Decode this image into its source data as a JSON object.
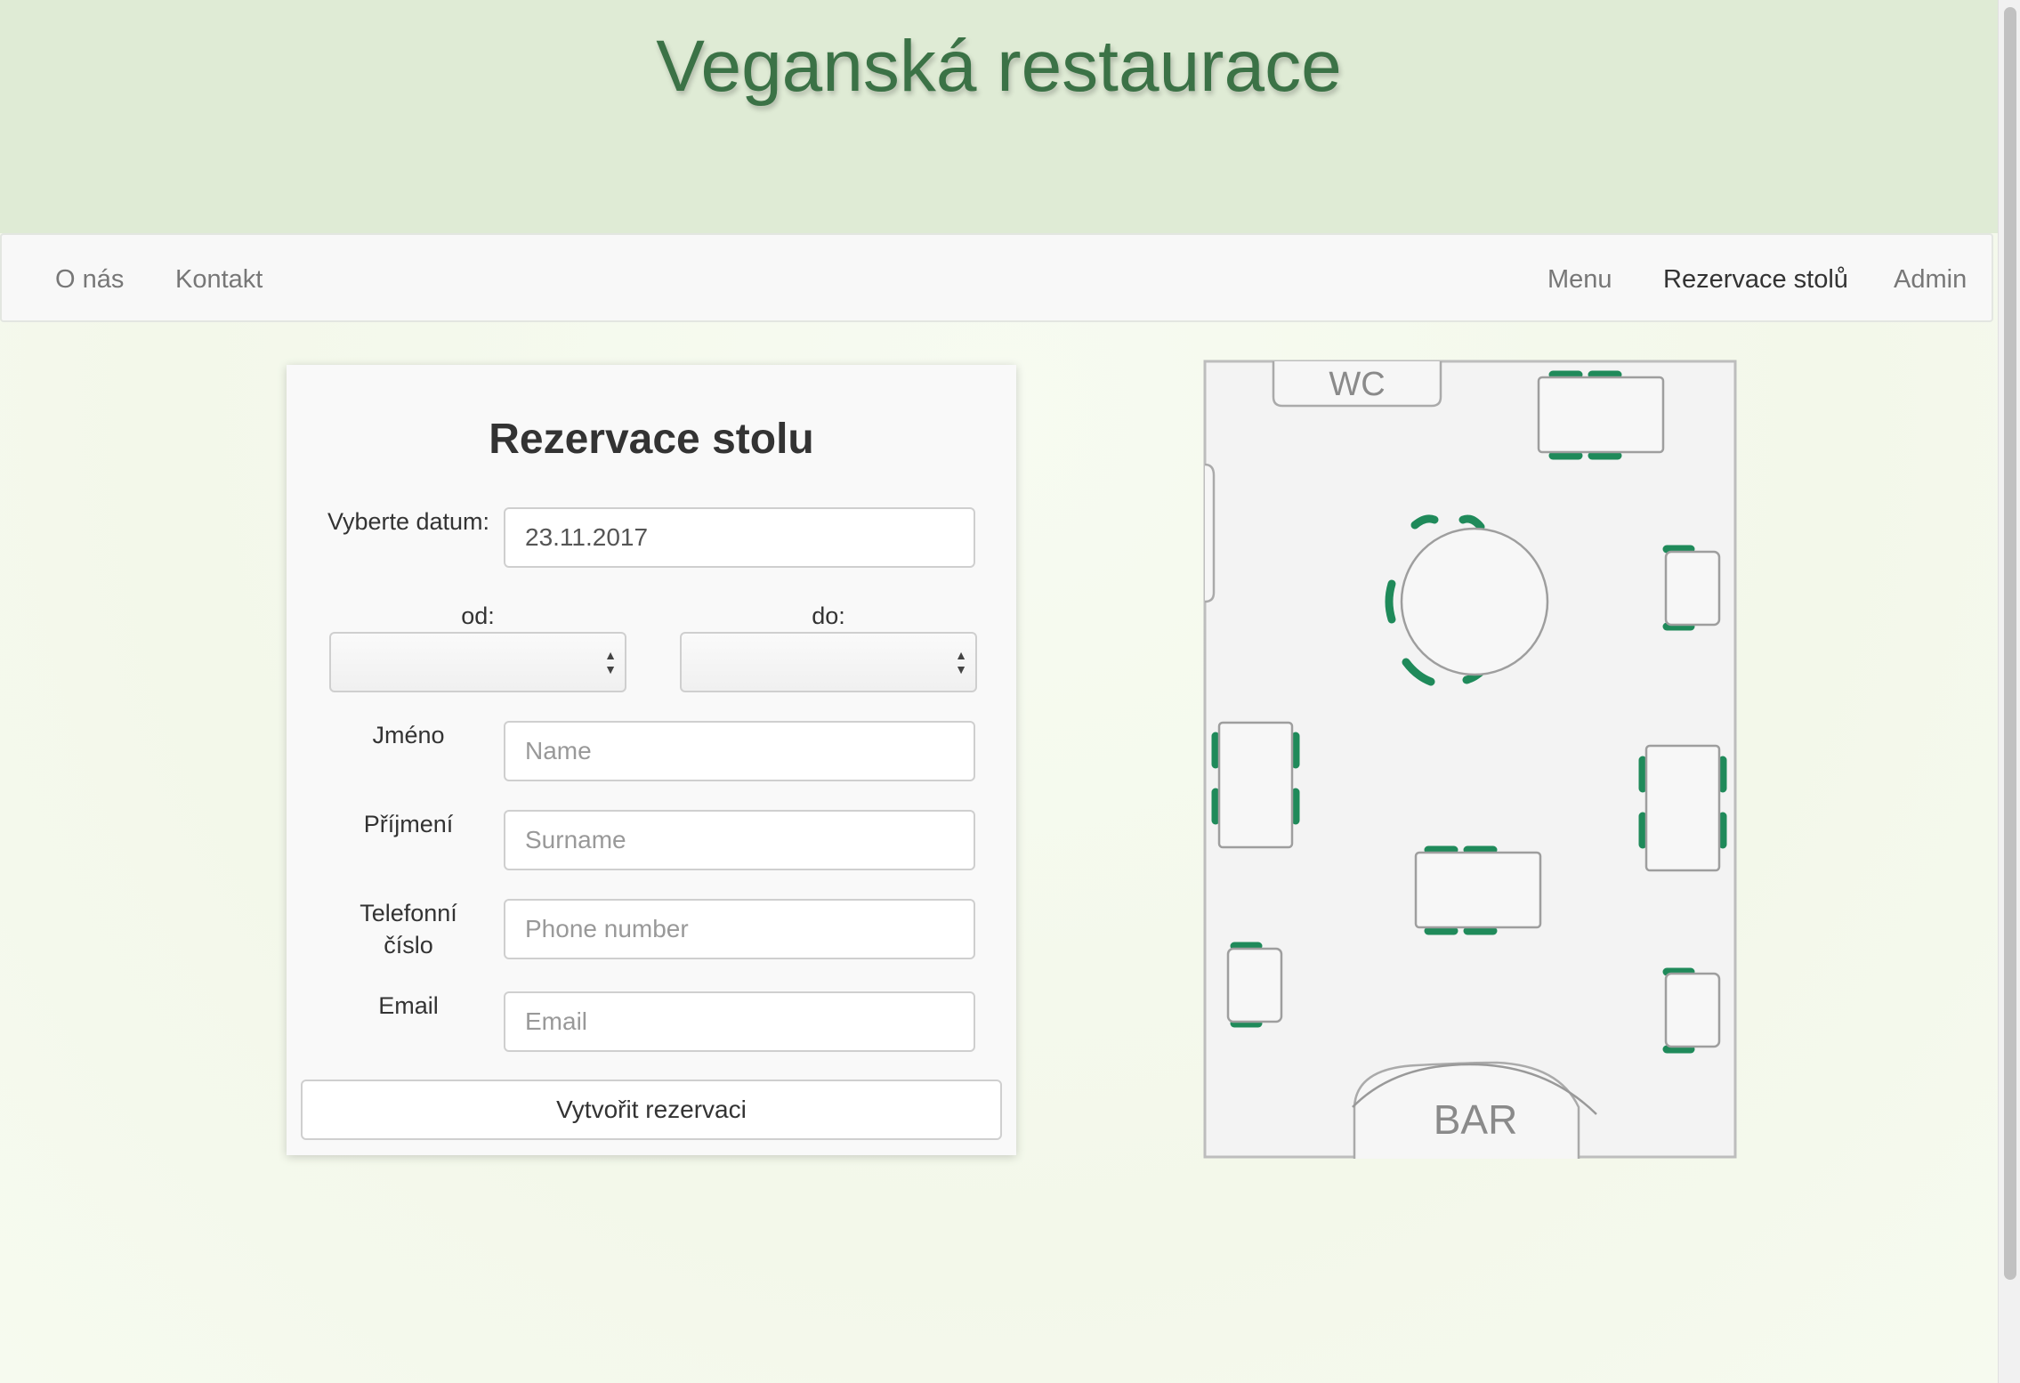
{
  "header": {
    "title": "Veganská restaurace"
  },
  "nav": {
    "left": [
      "O nás",
      "Kontakt"
    ],
    "right": [
      "Menu",
      "Rezervace stolů",
      "Admin"
    ],
    "active": "Rezervace stolů"
  },
  "form": {
    "title": "Rezervace stolu",
    "date_label": "Vyberte datum:",
    "date_value": "23.11.2017",
    "from_label": "od:",
    "to_label": "do:",
    "name_label": "Jméno",
    "name_placeholder": "Name",
    "surname_label": "Příjmení",
    "surname_placeholder": "Surname",
    "phone_label": "Telefonní číslo",
    "phone_placeholder": "Phone number",
    "email_label": "Email",
    "email_placeholder": "Email",
    "submit_label": "Vytvořit rezervaci"
  },
  "floorplan": {
    "wc_label": "WC",
    "bar_label": "BAR",
    "chair_color": "#1f8a5a",
    "table_count": 10
  }
}
